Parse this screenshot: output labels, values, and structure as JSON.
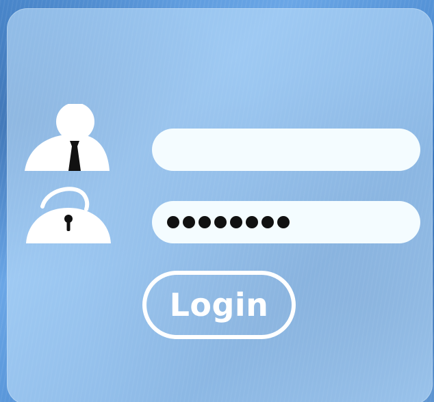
{
  "login_button": {
    "label": "Login"
  },
  "password_field": {
    "masked_length": 8
  },
  "icons": {
    "user": "user-icon",
    "lock": "lock-icon"
  },
  "colors": {
    "field_background": "#f4fcff",
    "button_border": "#ffffff",
    "tie": "#111111"
  }
}
